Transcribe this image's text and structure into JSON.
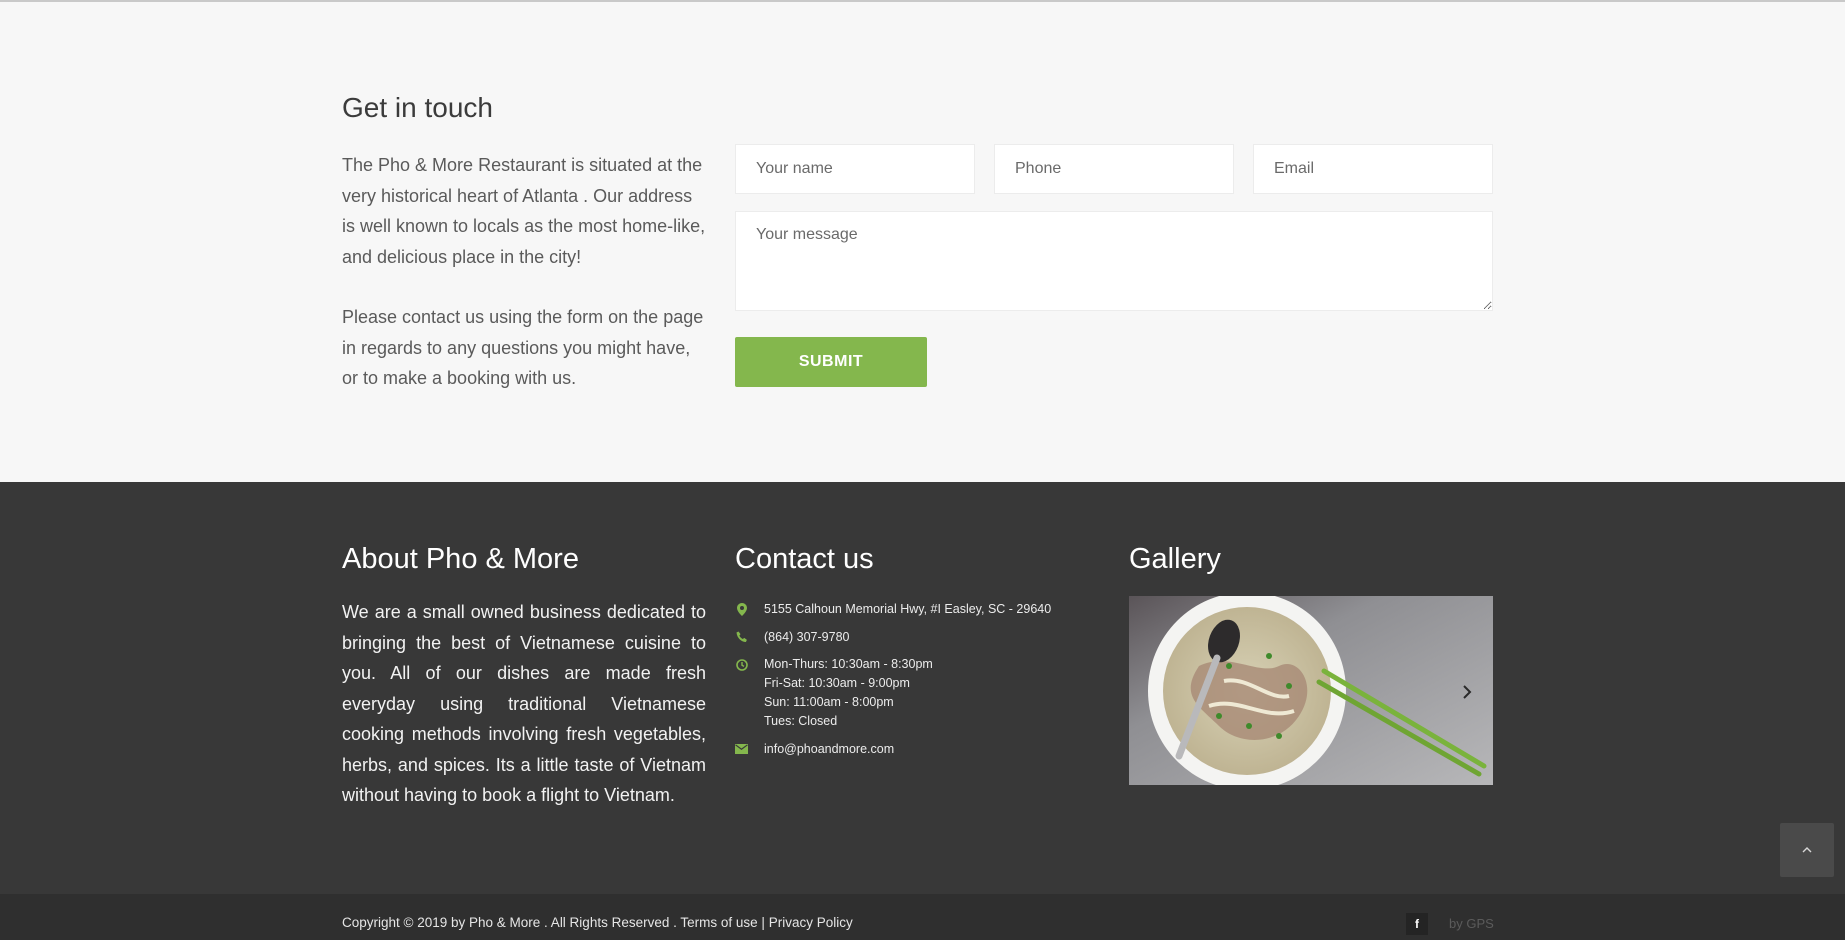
{
  "contact_section": {
    "heading": "Get in touch",
    "paragraph1": "The Pho & More Restaurant is situated at the very historical heart of Atlanta . Our address is well known to locals as the most home-like, and delicious place in the city!",
    "paragraph2": "Please contact us using the form on the page in regards to any questions you might have, or to make a booking with us.",
    "form": {
      "name_placeholder": "Your name",
      "phone_placeholder": "Phone",
      "email_placeholder": "Email",
      "message_placeholder": "Your message",
      "submit_label": "SUBMIT"
    }
  },
  "footer": {
    "about": {
      "title": "About Pho & More",
      "text": "We are a small owned business dedicated to bringing the best of Vietnamese cuisine to you. All of our dishes are made fresh everyday using traditional Vietnamese cooking methods involving fresh vegetables, herbs, and spices. Its a little taste of Vietnam without having to book a flight to Vietnam."
    },
    "contact": {
      "title": "Contact us",
      "address": "5155 Calhoun Memorial Hwy, #I Easley, SC - 29640",
      "phone": "(864) 307-9780",
      "hours": [
        "Mon-Thurs: 10:30am - 8:30pm",
        "Fri-Sat: 10:30am - 9:00pm",
        "Sun: 11:00am - 8:00pm",
        "Tues: Closed"
      ],
      "email": "info@phoandmore.com",
      "icons": [
        "map-marker-icon",
        "phone-icon",
        "clock-icon",
        "envelope-icon"
      ]
    },
    "gallery": {
      "title": "Gallery",
      "next_icon": "chevron-right-icon"
    }
  },
  "bottom_bar": {
    "copyright": "Copyright © 2019 by Pho & More . All Rights Reserved .",
    "terms_link": "Terms of use",
    "separator": "|",
    "privacy_link": "Privacy Policy",
    "social_label": "f",
    "credit": "by GPS"
  },
  "colors": {
    "accent": "#84b74d",
    "footer_bg": "#383838",
    "bottom_bar_bg": "#2f2f2f",
    "section_bg": "#f7f7f7"
  }
}
